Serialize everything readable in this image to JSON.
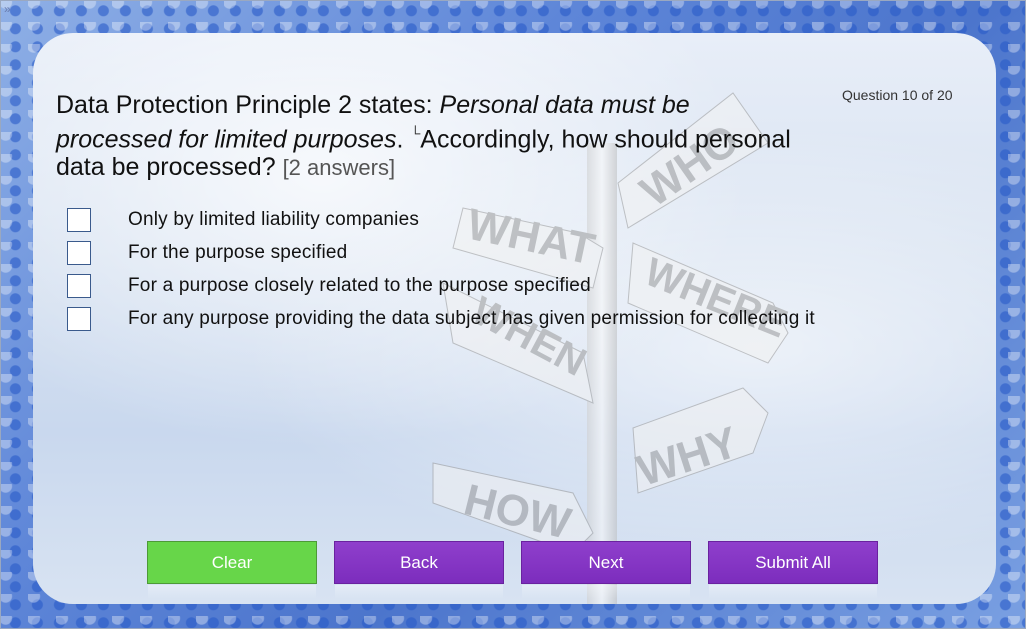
{
  "header": {
    "expand_glyph": "»"
  },
  "counter": "Question 10 of 20",
  "question": {
    "prefix": "Data Protection Principle 2 states: ",
    "emphasis": "Personal data must be processed for limited purposes",
    "period": ".",
    "corner_mark": "└",
    "rest": "Accordingly, how should personal data be processed?",
    "hint": "[2 answers]"
  },
  "options": [
    {
      "label": "Only by limited liability companies",
      "checked": false
    },
    {
      "label": "For the purpose specified",
      "checked": false
    },
    {
      "label": "For a purpose closely related to the purpose specified",
      "checked": false
    },
    {
      "label": "For any purpose providing the data subject has given permission for collecting it",
      "checked": false
    }
  ],
  "signpost_words": [
    "WHO",
    "WHAT",
    "WHERE",
    "WHEN",
    "WHY",
    "HOW"
  ],
  "buttons": {
    "clear": "Clear",
    "back": "Back",
    "next": "Next",
    "submit_all": "Submit All"
  },
  "colors": {
    "clear_button": "#67d649",
    "nav_buttons": "#8231c2",
    "checkbox_border": "#3a5a8c"
  }
}
